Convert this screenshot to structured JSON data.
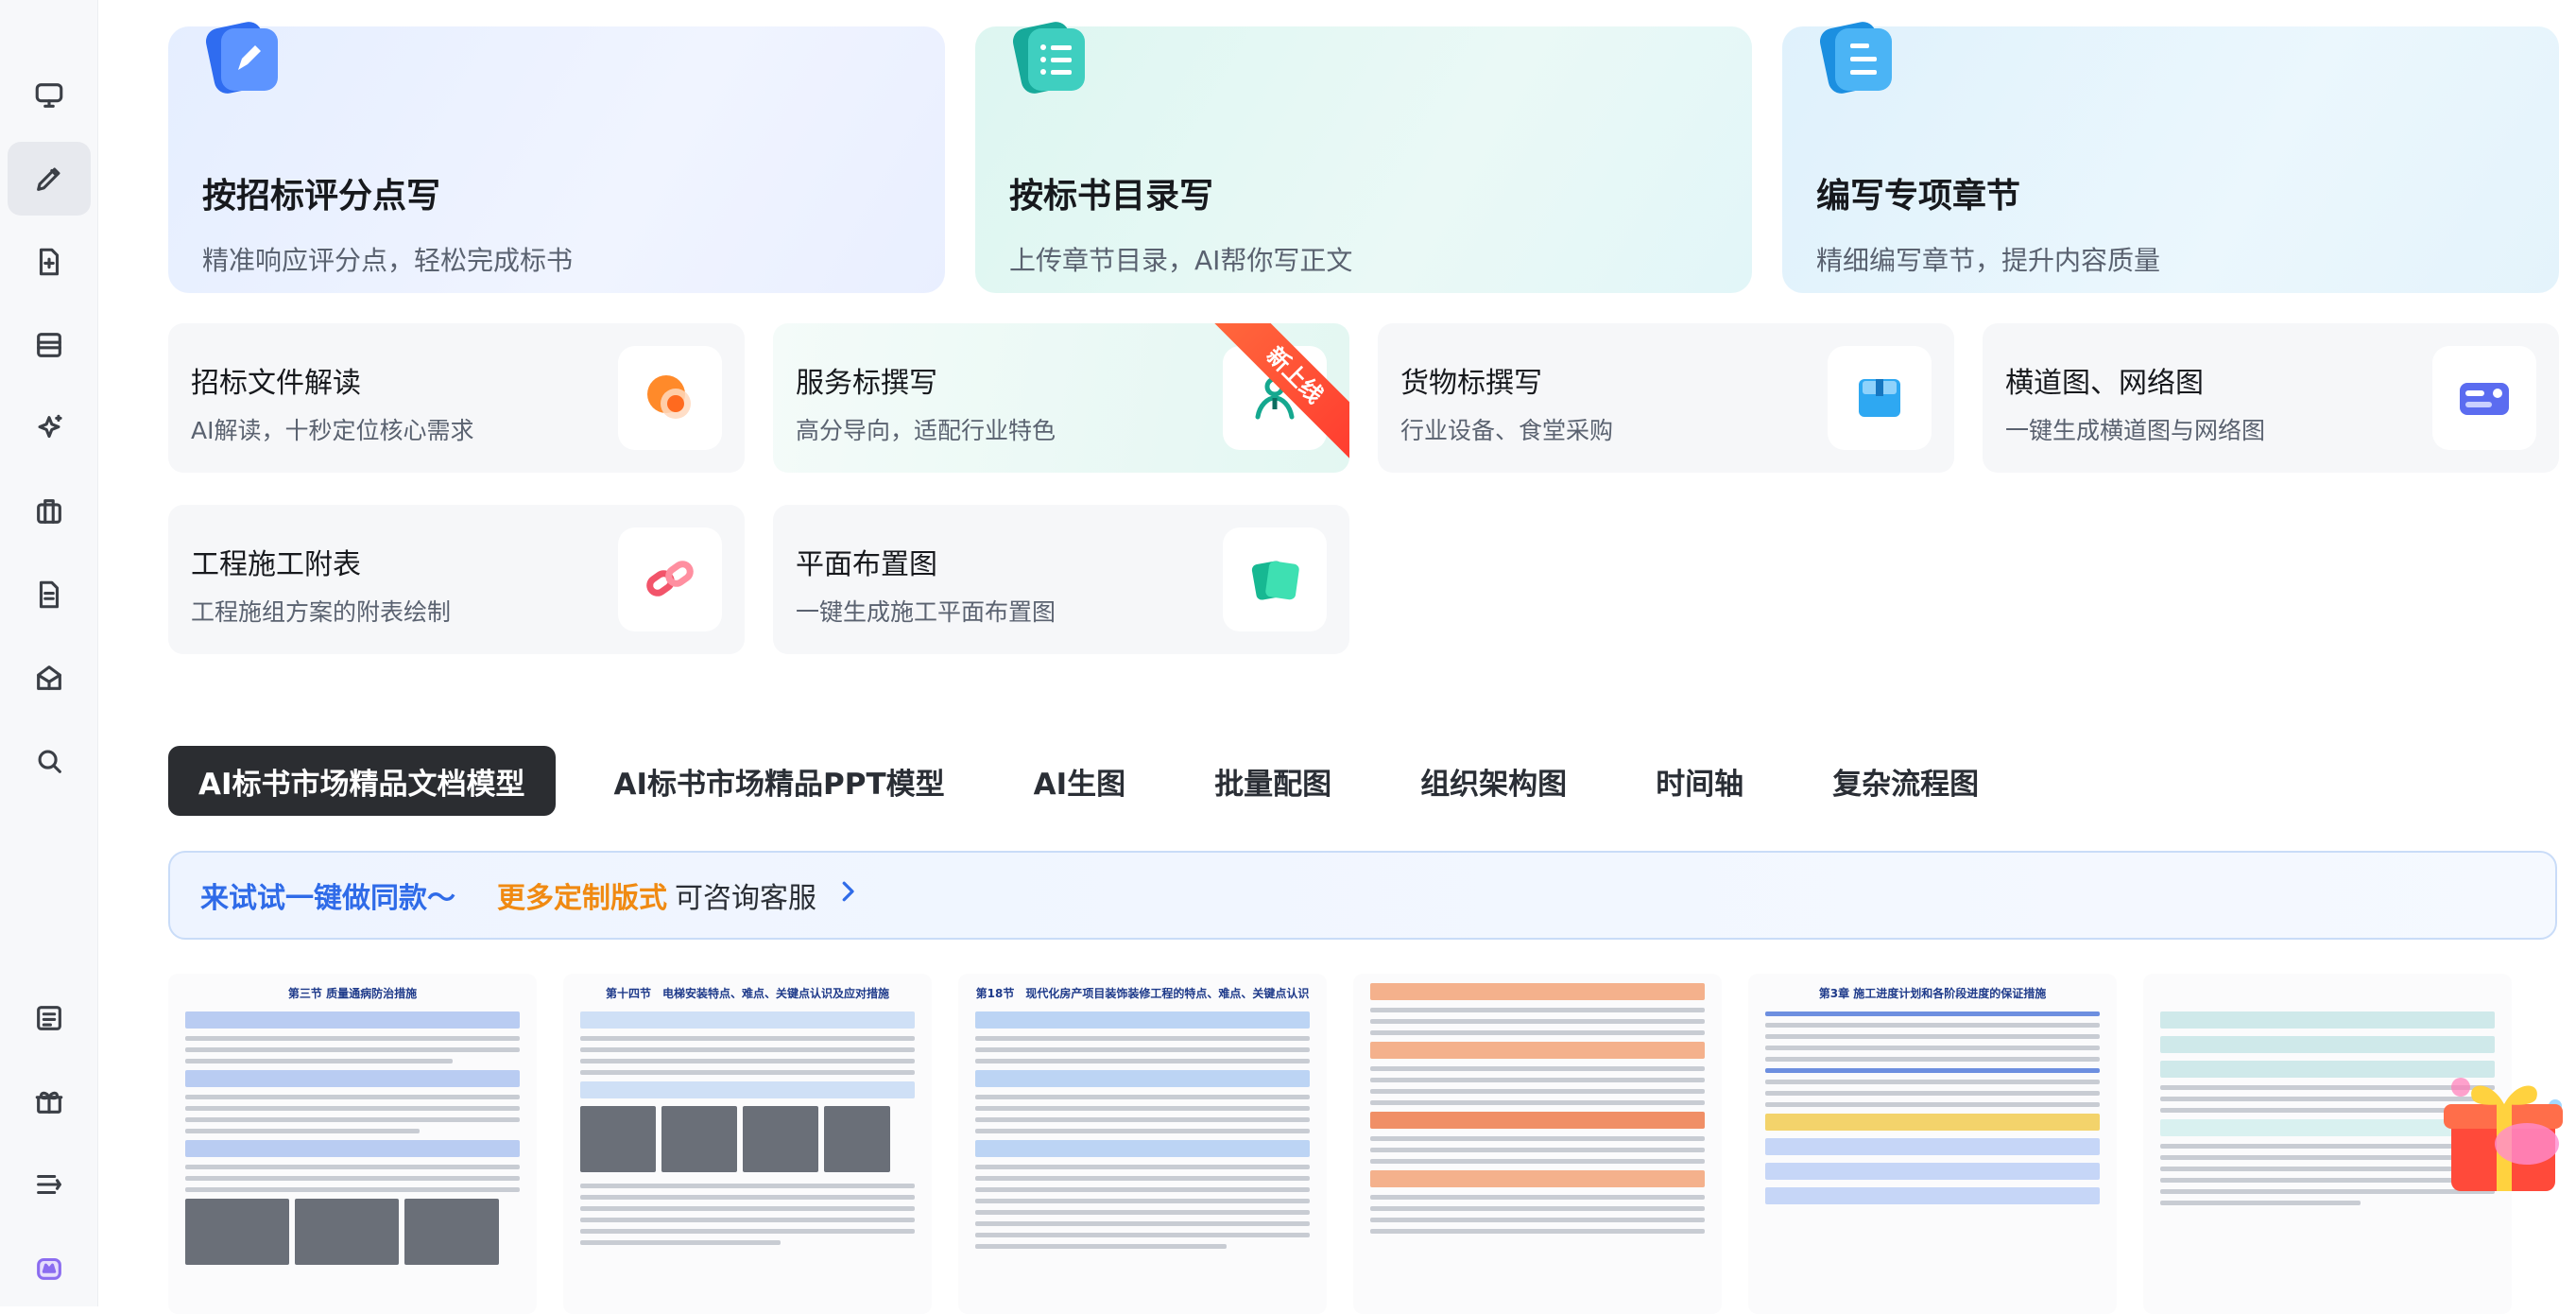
{
  "sidebar": {
    "items": [
      {
        "name": "monitor-icon"
      },
      {
        "name": "pencil-icon"
      },
      {
        "name": "file-add-icon"
      },
      {
        "name": "layout-icon"
      },
      {
        "name": "sparkle-icon"
      },
      {
        "name": "briefcase-icon"
      },
      {
        "name": "document-icon"
      },
      {
        "name": "box-icon"
      },
      {
        "name": "search-icon"
      },
      {
        "name": "list-icon"
      },
      {
        "name": "gift-icon"
      },
      {
        "name": "menu-icon"
      },
      {
        "name": "crown-avatar-icon"
      }
    ]
  },
  "hero_cards": [
    {
      "title": "按招标评分点写",
      "subtitle": "精准响应评分点，轻松完成标书",
      "icon": "pen-doc-icon",
      "color": "#3b7cf5"
    },
    {
      "title": "按标书目录写",
      "subtitle": "上传章节目录，AI帮你写正文",
      "icon": "list-doc-icon",
      "color": "#22b8a8"
    },
    {
      "title": "编写专项章节",
      "subtitle": "精细编写章节，提升内容质量",
      "icon": "file-doc-icon",
      "color": "#3aa6f0"
    }
  ],
  "feature_cards": [
    {
      "title": "招标文件解读",
      "subtitle": "AI解读，十秒定位核心需求",
      "icon": "orange-circles-icon"
    },
    {
      "title": "服务标撰写",
      "subtitle": "高分导向，适配行业特色",
      "icon": "person-service-icon",
      "badge": "新上线"
    },
    {
      "title": "货物标撰写",
      "subtitle": "行业设备、食堂采购",
      "icon": "box-package-icon"
    },
    {
      "title": "横道图、网络图",
      "subtitle": "一键生成横道图与网络图",
      "icon": "gantt-toggle-icon"
    },
    {
      "title": "工程施工附表",
      "subtitle": "工程施组方案的附表绘制",
      "icon": "chain-link-icon"
    },
    {
      "title": "平面布置图",
      "subtitle": "一键生成施工平面布置图",
      "icon": "green-cards-icon"
    }
  ],
  "tabs": [
    {
      "label": "AI标书市场精品文档模型",
      "active": true
    },
    {
      "label": "AI标书市场精品PPT模型",
      "active": false
    },
    {
      "label": "AI生图",
      "active": false
    },
    {
      "label": "批量配图",
      "active": false
    },
    {
      "label": "组织架构图",
      "active": false
    },
    {
      "label": "时间轴",
      "active": false
    },
    {
      "label": "复杂流程图",
      "active": false
    }
  ],
  "banner": {
    "try_text": "来试试一键做同款～",
    "custom_text": "更多定制版式",
    "consult_text": "可咨询客服"
  },
  "documents": [
    {
      "title": "第三节 质量通病防治措施"
    },
    {
      "title": "第十四节　电梯安装特点、难点、关键点认识及应对措施"
    },
    {
      "title": "第18节　现代化房产项目装饰装修工程的特点、难点、关键点认识"
    },
    {
      "title": ""
    },
    {
      "title": "第3章 施工进度计划和各阶段进度的保证措施"
    },
    {
      "title": ""
    }
  ]
}
